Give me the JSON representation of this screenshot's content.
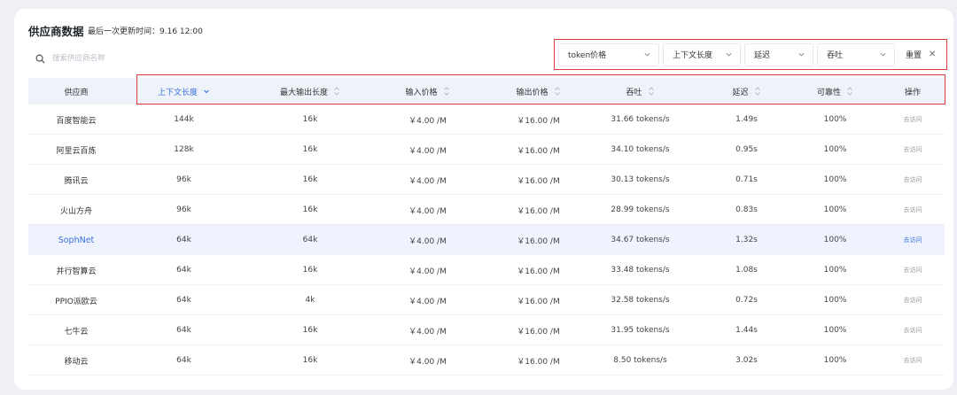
{
  "header": {
    "title": "供应商数据",
    "updated": "最后一次更新时间：9.16 12:00"
  },
  "search": {
    "placeholder": "搜索供应商名称",
    "value": ""
  },
  "filters": {
    "token_price": "token价格",
    "context_length": "上下文长度",
    "latency": "延迟",
    "throughput": "吞吐",
    "reset": "重置",
    "reset_icon": "✕"
  },
  "table": {
    "columns": [
      "供应商",
      "上下文长度",
      "最大输出长度",
      "输入价格",
      "输出价格",
      "吞吐",
      "延迟",
      "可靠性",
      "操作"
    ],
    "active_sort_column": "上下文长度",
    "accent_color": "#3c6fe0",
    "rows": [
      [
        "百度智能云",
        "144k",
        "16k",
        "￥4.00 /M",
        "￥16.00 /M",
        "31.66 tokens/s",
        "1.49s",
        "100%",
        "去访问"
      ],
      [
        "阿里云百炼",
        "128k",
        "16k",
        "￥4.00 /M",
        "￥16.00 /M",
        "34.10 tokens/s",
        "0.95s",
        "100%",
        "去访问"
      ],
      [
        "腾讯云",
        "96k",
        "16k",
        "￥4.00 /M",
        "￥16.00 /M",
        "30.13 tokens/s",
        "0.71s",
        "100%",
        "去访问"
      ],
      [
        "火山方舟",
        "96k",
        "16k",
        "￥4.00 /M",
        "￥16.00 /M",
        "28.99 tokens/s",
        "0.83s",
        "100%",
        "去访问"
      ],
      [
        "SophNet",
        "64k",
        "64k",
        "￥4.00 /M",
        "￥16.00 /M",
        "34.67 tokens/s",
        "1.32s",
        "100%",
        "去访问"
      ],
      [
        "并行智算云",
        "64k",
        "16k",
        "￥4.00 /M",
        "￥16.00 /M",
        "33.48 tokens/s",
        "1.08s",
        "100%",
        "去访问"
      ],
      [
        "PPIO派欧云",
        "64k",
        "4k",
        "￥4.00 /M",
        "￥16.00 /M",
        "32.58 tokens/s",
        "0.72s",
        "100%",
        "去访问"
      ],
      [
        "七牛云",
        "64k",
        "16k",
        "￥4.00 /M",
        "￥16.00 /M",
        "31.95 tokens/s",
        "1.44s",
        "100%",
        "去访问"
      ],
      [
        "移动云",
        "64k",
        "16k",
        "￥4.00 /M",
        "￥16.00 /M",
        "8.50 tokens/s",
        "3.02s",
        "100%",
        "去访问"
      ]
    ],
    "highlighted_row": "SophNet"
  }
}
